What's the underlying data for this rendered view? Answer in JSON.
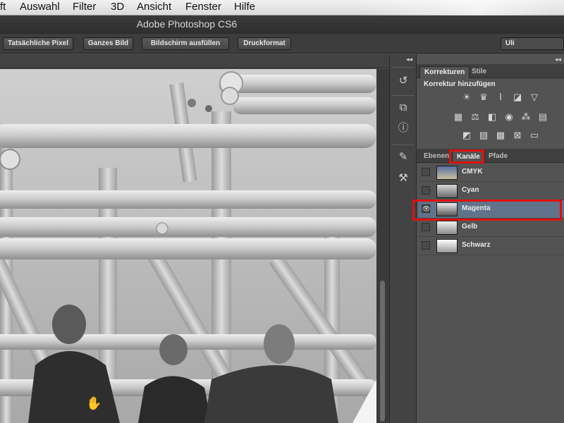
{
  "menubar": {
    "items": [
      "ft",
      "Auswahl",
      "Filter",
      "3D",
      "Ansicht",
      "Fenster",
      "Hilfe"
    ]
  },
  "titlebar": {
    "title": "Adobe Photoshop CS6"
  },
  "options": {
    "buttons": [
      "Tatsächliche Pixel",
      "Ganzes Bild",
      "Bildschirm ausfüllen",
      "Druckformat"
    ],
    "workspace": "Uli"
  },
  "panels": {
    "collapse_glyph": "◂◂",
    "adjustments": {
      "tabs": [
        "Korrekturen",
        "Stile"
      ],
      "heading": "Korrektur hinzufügen"
    },
    "channels": {
      "tabs": [
        "Ebenen",
        "Kanäle",
        "Pfade"
      ],
      "active_tab": "Kanäle",
      "rows": [
        {
          "name": "CMYK",
          "visible": false,
          "selected": false
        },
        {
          "name": "Cyan",
          "visible": false,
          "selected": false
        },
        {
          "name": "Magenta",
          "visible": true,
          "selected": true
        },
        {
          "name": "Gelb",
          "visible": false,
          "selected": false
        },
        {
          "name": "Schwarz",
          "visible": false,
          "selected": false
        }
      ]
    }
  },
  "colors": {
    "highlight": "#e01010",
    "selected_row": "#60738a"
  }
}
